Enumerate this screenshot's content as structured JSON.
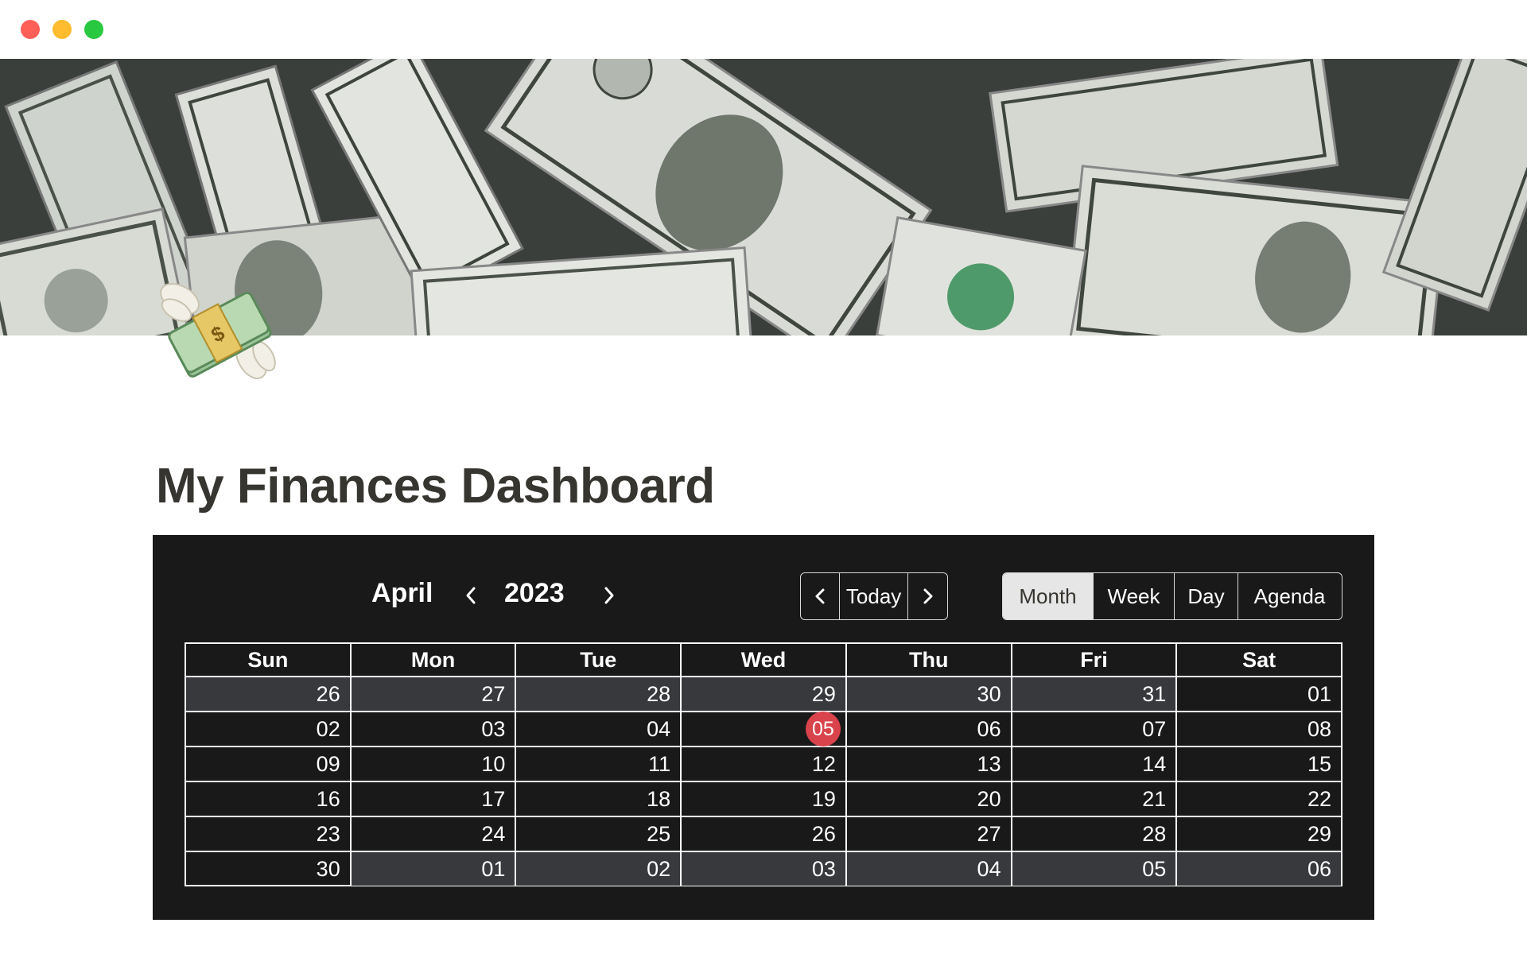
{
  "page": {
    "title": "My Finances Dashboard",
    "icon": "money-with-wings-icon"
  },
  "calendar": {
    "month": "April",
    "year": "2023",
    "nav": {
      "prev_icon": "chevron-left-icon",
      "today_label": "Today",
      "next_icon": "chevron-right-icon"
    },
    "views": [
      {
        "label": "Month",
        "active": true
      },
      {
        "label": "Week",
        "active": false
      },
      {
        "label": "Day",
        "active": false
      },
      {
        "label": "Agenda",
        "active": false
      }
    ],
    "weekdays": [
      "Sun",
      "Mon",
      "Tue",
      "Wed",
      "Thu",
      "Fri",
      "Sat"
    ],
    "weeks": [
      [
        {
          "d": "26",
          "off": true
        },
        {
          "d": "27",
          "off": true
        },
        {
          "d": "28",
          "off": true
        },
        {
          "d": "29",
          "off": true
        },
        {
          "d": "30",
          "off": true
        },
        {
          "d": "31",
          "off": true
        },
        {
          "d": "01",
          "off": false
        }
      ],
      [
        {
          "d": "02",
          "off": false
        },
        {
          "d": "03",
          "off": false
        },
        {
          "d": "04",
          "off": false
        },
        {
          "d": "05",
          "off": false,
          "today": true
        },
        {
          "d": "06",
          "off": false
        },
        {
          "d": "07",
          "off": false
        },
        {
          "d": "08",
          "off": false
        }
      ],
      [
        {
          "d": "09",
          "off": false
        },
        {
          "d": "10",
          "off": false
        },
        {
          "d": "11",
          "off": false
        },
        {
          "d": "12",
          "off": false
        },
        {
          "d": "13",
          "off": false
        },
        {
          "d": "14",
          "off": false
        },
        {
          "d": "15",
          "off": false
        }
      ],
      [
        {
          "d": "16",
          "off": false
        },
        {
          "d": "17",
          "off": false
        },
        {
          "d": "18",
          "off": false
        },
        {
          "d": "19",
          "off": false
        },
        {
          "d": "20",
          "off": false
        },
        {
          "d": "21",
          "off": false
        },
        {
          "d": "22",
          "off": false
        }
      ],
      [
        {
          "d": "23",
          "off": false
        },
        {
          "d": "24",
          "off": false
        },
        {
          "d": "25",
          "off": false
        },
        {
          "d": "26",
          "off": false
        },
        {
          "d": "27",
          "off": false
        },
        {
          "d": "28",
          "off": false
        },
        {
          "d": "29",
          "off": false
        }
      ],
      [
        {
          "d": "30",
          "off": false
        },
        {
          "d": "01",
          "off": true
        },
        {
          "d": "02",
          "off": true
        },
        {
          "d": "03",
          "off": true
        },
        {
          "d": "04",
          "off": true
        },
        {
          "d": "05",
          "off": true
        },
        {
          "d": "06",
          "off": true
        }
      ]
    ],
    "colors": {
      "background": "#191919",
      "off_day": "#37393c",
      "today": "#d9434b",
      "active_view": "#e6e6e6"
    }
  }
}
